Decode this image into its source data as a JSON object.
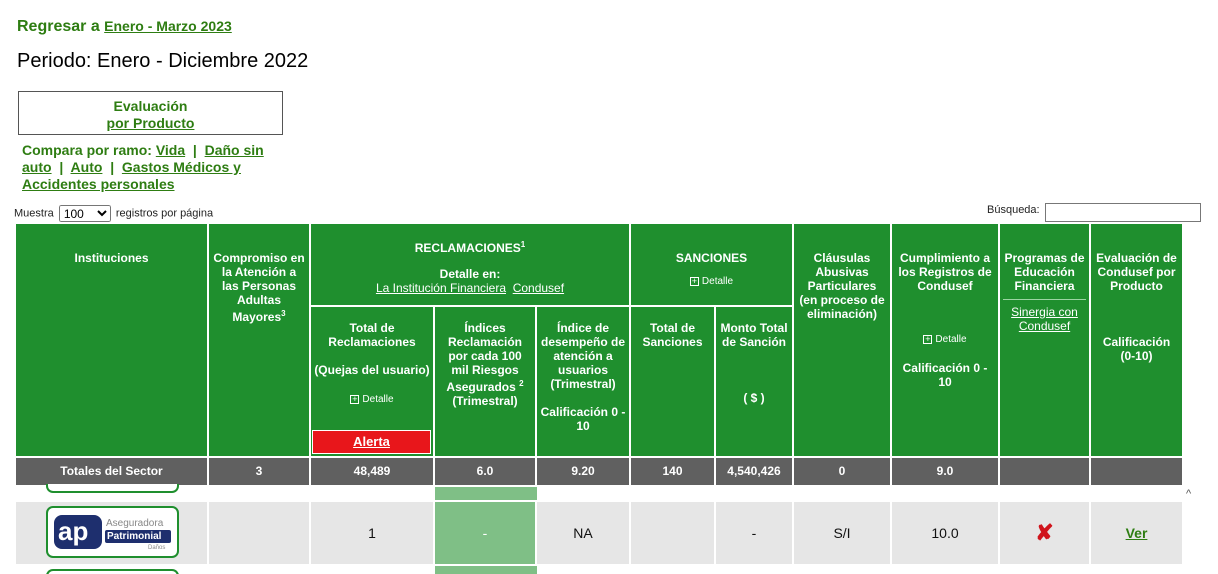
{
  "back": {
    "prefix": "Regresar a",
    "link": "Enero - Marzo 2023"
  },
  "period": "Periodo: Enero - Diciembre 2022",
  "eval_box": {
    "line1": "Evaluación",
    "line2": "por Producto"
  },
  "ramo": {
    "prefix": "Compara por ramo:",
    "items": [
      "Vida",
      "Daño sin auto",
      "Auto",
      "Gastos Médicos y Accidentes personales"
    ]
  },
  "muestra": {
    "prefix": "Muestra",
    "selected": "100",
    "suffix": "registros por página"
  },
  "busqueda": {
    "label": "Búsqueda:",
    "value": ""
  },
  "header": {
    "instituciones": "Instituciones",
    "compromiso": "Compromiso en la Atención a las Personas Adultas Mayores",
    "compromiso_sup": "3",
    "reclamaciones": "RECLAMACIONES",
    "reclamaciones_sup": "1",
    "detalle_en": "Detalle en:",
    "link_inst": "La Institución Financiera",
    "link_condusef": "Condusef",
    "sanciones": "SANCIONES",
    "detalle": "Detalle",
    "clausulas": "Cláusulas Abusivas Particulares (en proceso de eliminación)",
    "cumplimiento": "Cumplimiento a los Registros de Condusef",
    "calif_0_10": "Calificación 0 - 10",
    "programas": "Programas de Educación Financiera",
    "sinergia": "Sinergia con Condusef",
    "evaluacion": "Evaluación de Condusef por Producto",
    "calif_paren": "Calificación (0-10)",
    "total_rec": "Total de Reclamaciones",
    "quejas": "(Quejas del usuario)",
    "alerta": "Alerta",
    "indices": "Índices Reclamación por cada 100 mil Riesgos Asegurados",
    "indices_sup": "2",
    "trimestral": "(Trimestral)",
    "desempeno": "Índice de desempeño de atención a usuarios (Trimestral)",
    "total_sanc": "Total de Sanciones",
    "monto": "Monto Total de Sanción",
    "monto_unit": "( $ )"
  },
  "totals": {
    "label": "Totales del Sector",
    "compromiso": "3",
    "total_rec": "48,489",
    "indices": "6.0",
    "desempeno": "9.20",
    "total_sanc": "140",
    "monto": "4,540,426",
    "clausulas": "0",
    "cumplimiento": "9.0"
  },
  "row": {
    "logo_ap": "ap",
    "logo_line1": "Aseguradora",
    "logo_line2": "Patrimonial",
    "logo_line3": "Daños",
    "total_rec": "1",
    "indices": "-",
    "desempeno": "NA",
    "monto": "-",
    "clausulas": "S/I",
    "cumplimiento": "10.0",
    "programas_icon": "✘",
    "ver": "Ver"
  },
  "colors": {
    "green": "#1f8f2e",
    "link_green": "#2e7d12",
    "totals_gray": "#606060",
    "alert_red": "#e8161b"
  }
}
